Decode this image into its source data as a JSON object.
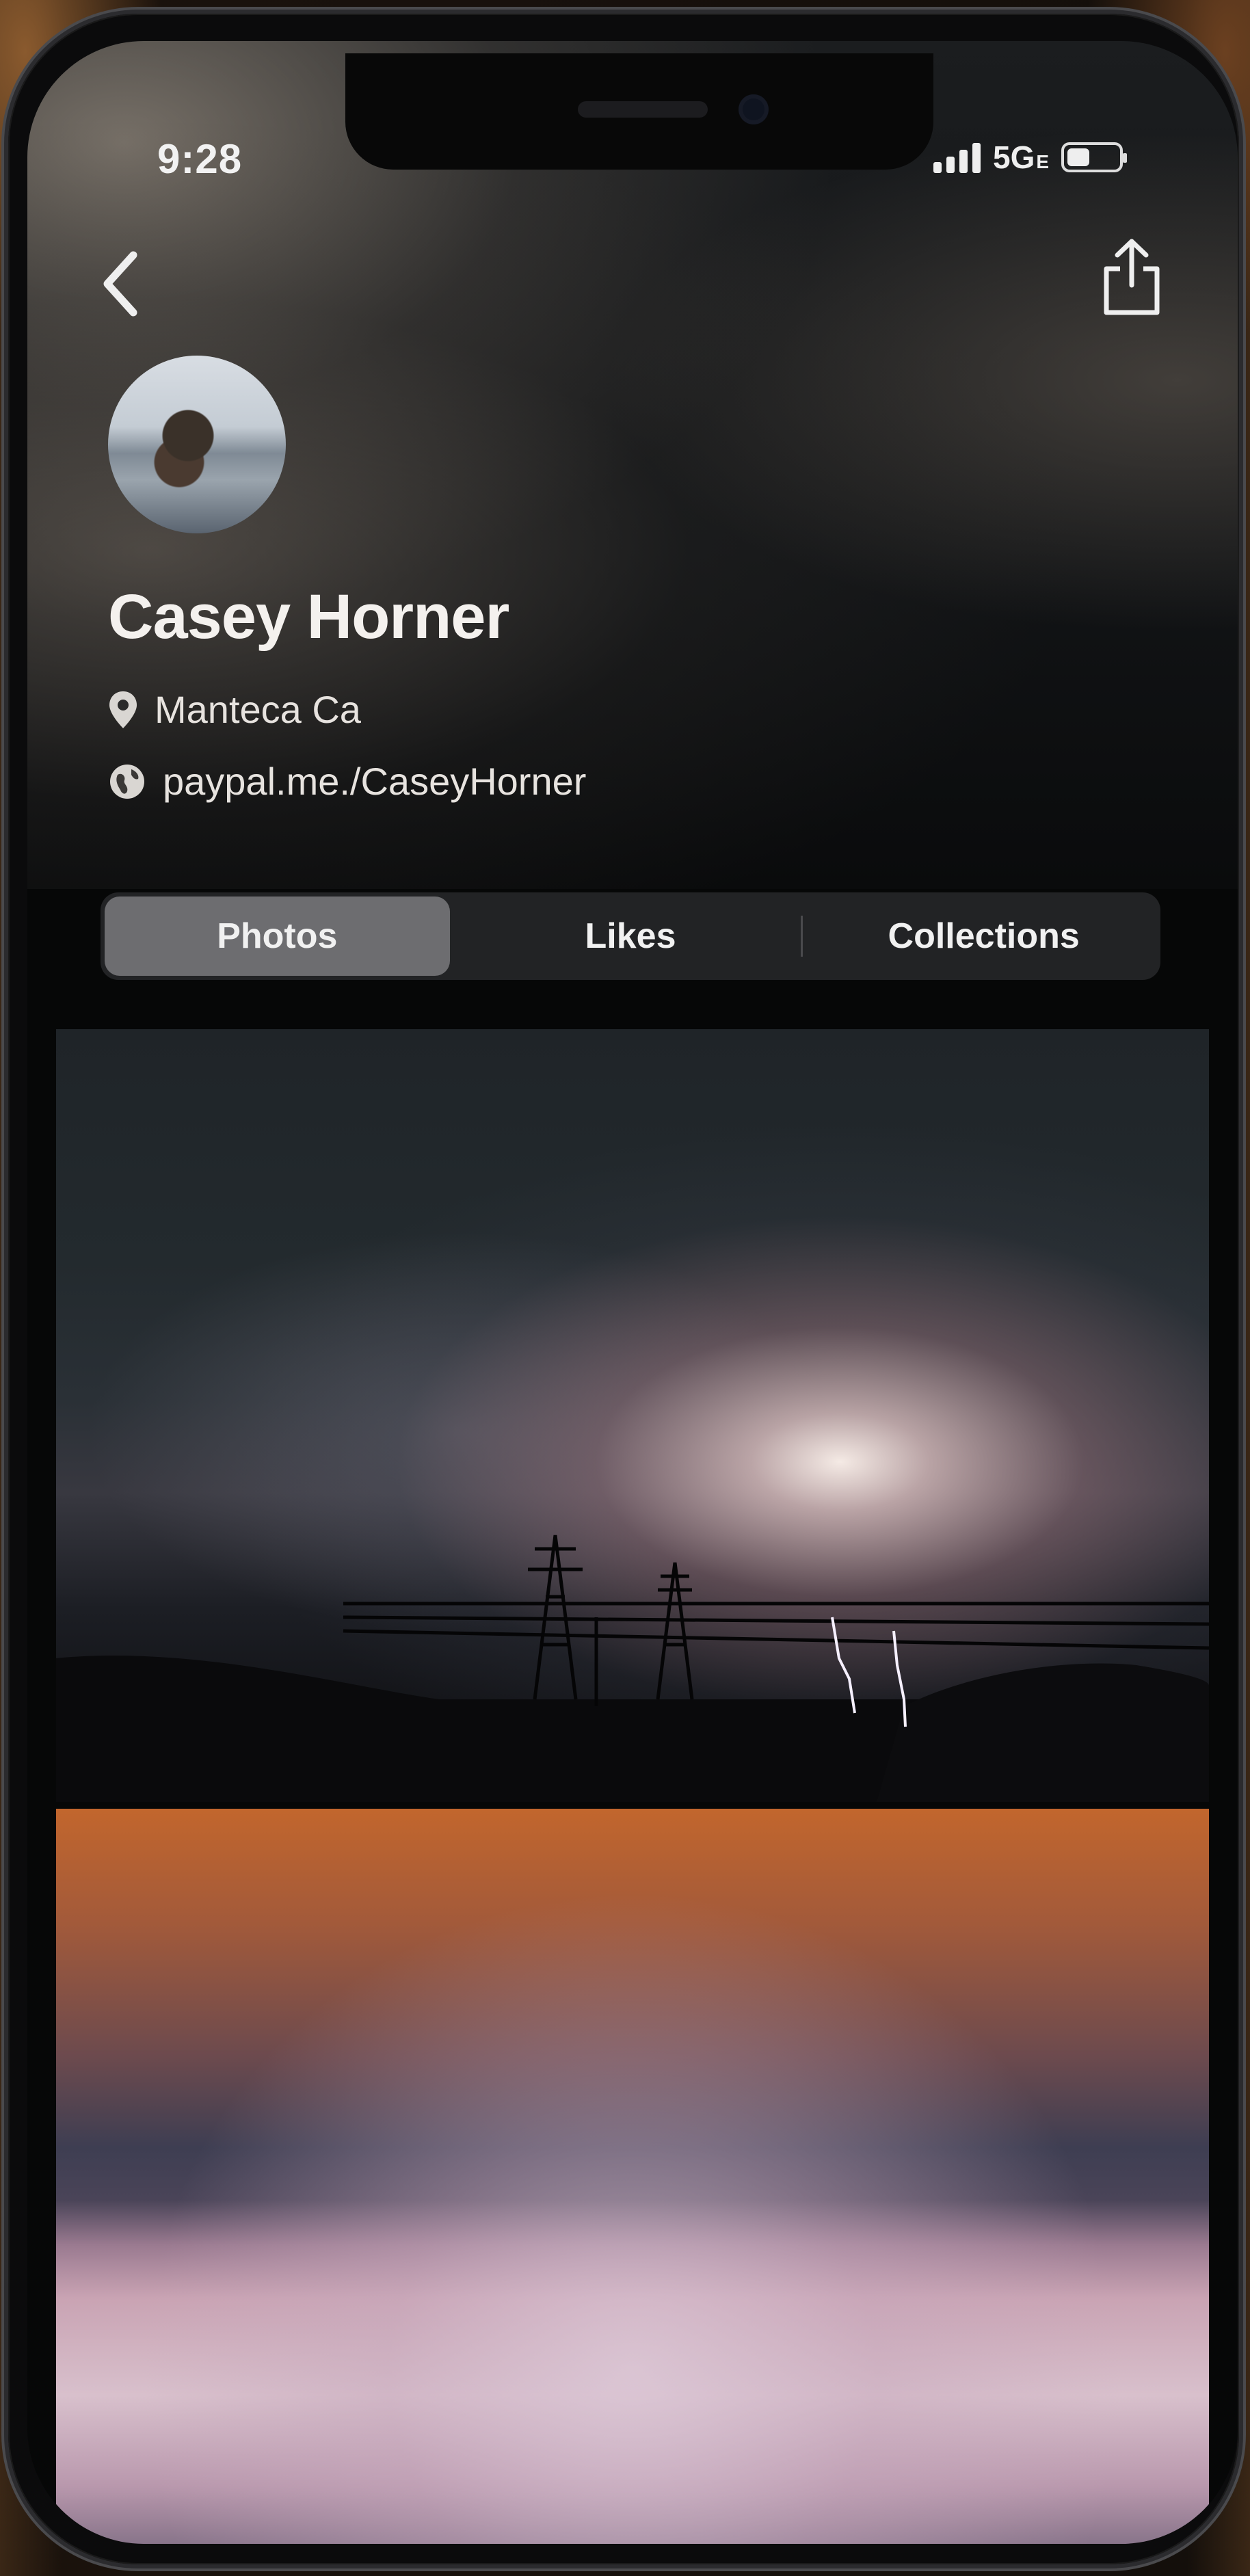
{
  "status_bar": {
    "time": "9:28",
    "network": "5G",
    "network_suffix": "E",
    "battery_level": 0.45
  },
  "toolbar": {
    "back_icon": "chevron-left-icon",
    "share_icon": "share-icon"
  },
  "profile": {
    "name": "Casey Horner",
    "location": "Manteca  Ca",
    "link": "paypal.me./CaseyHorner",
    "location_icon": "location-pin-icon",
    "link_icon": "globe-icon"
  },
  "tabs": [
    {
      "label": "Photos",
      "active": true
    },
    {
      "label": "Likes",
      "active": false
    },
    {
      "label": "Collections",
      "active": false
    }
  ],
  "photos": [
    {
      "subject": "lightning-storm-over-power-lines"
    },
    {
      "subject": "sunset-over-fog"
    }
  ]
}
